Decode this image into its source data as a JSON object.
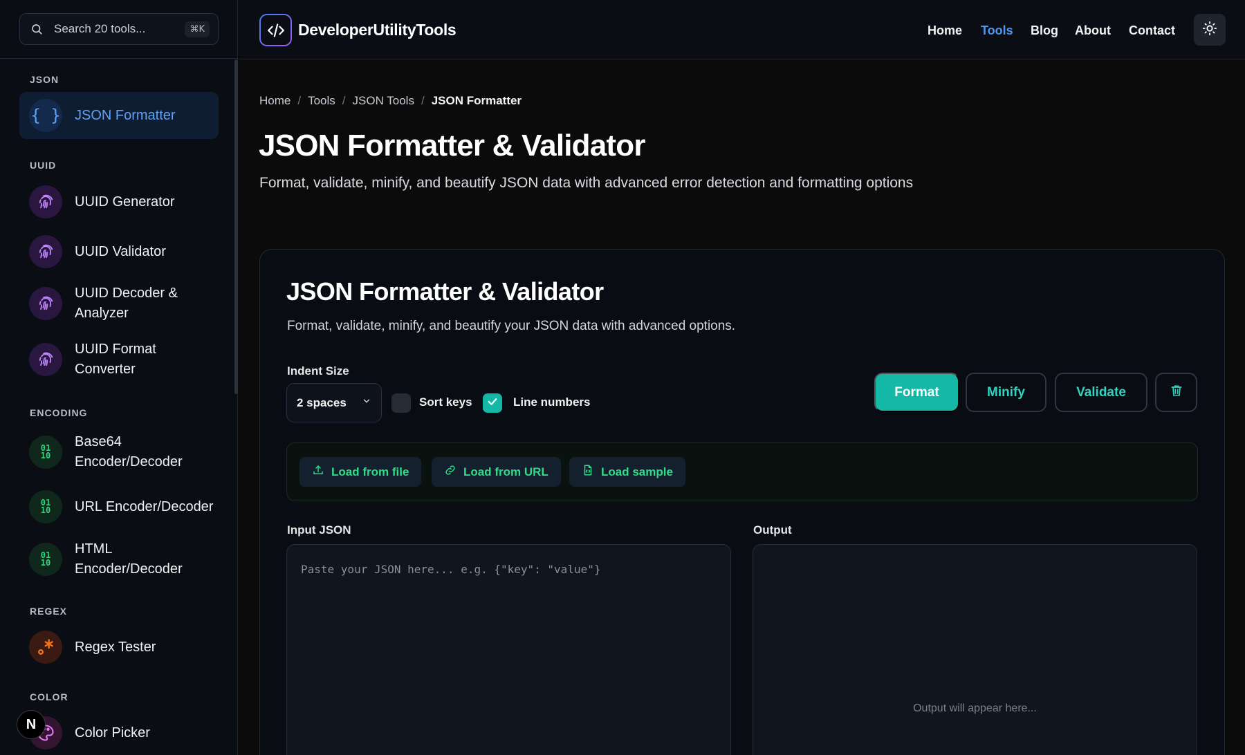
{
  "search": {
    "placeholder": "Search 20 tools...",
    "shortcut": "⌘K"
  },
  "sidebar": {
    "sections": [
      {
        "label": "JSON"
      },
      {
        "label": "UUID"
      },
      {
        "label": "ENCODING"
      },
      {
        "label": "REGEX"
      },
      {
        "label": "COLOR"
      }
    ],
    "items": [
      {
        "label": "JSON Formatter",
        "icon": "braces-icon",
        "active": true
      },
      {
        "label": "UUID Generator",
        "icon": "fingerprint-icon"
      },
      {
        "label": "UUID Validator",
        "icon": "fingerprint-icon"
      },
      {
        "label": "UUID Decoder & Analyzer",
        "icon": "fingerprint-icon"
      },
      {
        "label": "UUID Format Converter",
        "icon": "fingerprint-icon"
      },
      {
        "label": "Base64 Encoder/Decoder",
        "icon": "binary-icon"
      },
      {
        "label": "URL Encoder/Decoder",
        "icon": "binary-icon"
      },
      {
        "label": "HTML Encoder/Decoder",
        "icon": "binary-icon"
      },
      {
        "label": "Regex Tester",
        "icon": "regex-icon"
      },
      {
        "label": "Color Picker",
        "icon": "palette-icon"
      }
    ],
    "badge": "N",
    "binary_glyph": "01 10"
  },
  "header": {
    "brand": "DeveloperUtilityTools",
    "nav": [
      {
        "label": "Home"
      },
      {
        "label": "Tools",
        "current": true
      },
      {
        "label": "Blog"
      },
      {
        "label": "About"
      },
      {
        "label": "Contact"
      }
    ]
  },
  "breadcrumb": [
    "Home",
    "Tools",
    "JSON Tools",
    "JSON Formatter"
  ],
  "breadcrumb_sep": "/",
  "page": {
    "title": "JSON Formatter & Validator",
    "subtitle": "Format, validate, minify, and beautify JSON data with advanced error detection and formatting options"
  },
  "tool": {
    "title": "JSON Formatter & Validator",
    "subtitle": "Format, validate, minify, and beautify your JSON data with advanced options.",
    "indent_label": "Indent Size",
    "indent_value": "2 spaces",
    "sort_keys_label": "Sort keys",
    "sort_keys_checked": false,
    "line_numbers_label": "Line numbers",
    "line_numbers_checked": true,
    "buttons": {
      "format": "Format",
      "minify": "Minify",
      "validate": "Validate"
    },
    "load": {
      "file": "Load from file",
      "url": "Load from URL",
      "sample": "Load sample"
    },
    "input_label": "Input JSON",
    "input_placeholder": "Paste your JSON here... e.g. {\"key\": \"value\"}",
    "output_label": "Output",
    "output_placeholder": "Output will appear here..."
  },
  "colors": {
    "accent": "#14b8a6",
    "link": "#4e96f4",
    "green": "#2fdc87"
  }
}
